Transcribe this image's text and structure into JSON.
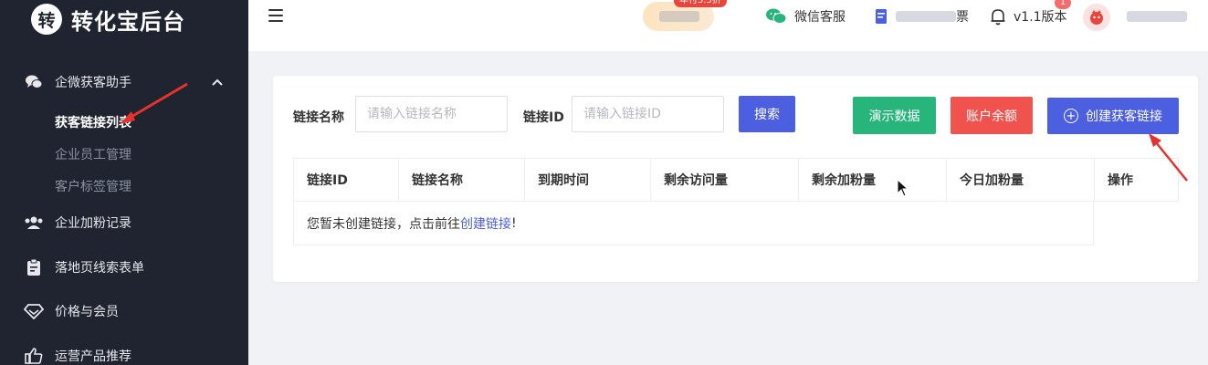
{
  "brand": {
    "logo_char": "转",
    "name": "转化宝后台"
  },
  "sidebar": {
    "groups": [
      {
        "label": "企微获客助手",
        "icon": "chat-bubbles-icon",
        "expanded": true
      },
      {
        "label": "企业加粉记录",
        "icon": "users-icon"
      },
      {
        "label": "落地页线索表单",
        "icon": "clipboard-icon"
      },
      {
        "label": "价格与会员",
        "icon": "diamond-icon"
      },
      {
        "label": "运营产品推荐",
        "icon": "thumbs-up-icon"
      }
    ],
    "submenu": [
      {
        "label": "获客链接列表",
        "active": true
      },
      {
        "label": "企业员工管理",
        "active": false
      },
      {
        "label": "客户标签管理",
        "active": false
      }
    ]
  },
  "topbar": {
    "promo_badge": "年付5.5折",
    "wechat_service": "微信客服",
    "invoice_label_tail": "票",
    "version": "v1.1版本",
    "notify_count": "1"
  },
  "filters": {
    "name_label": "链接名称",
    "name_placeholder": "请输入链接名称",
    "id_label": "链接ID",
    "id_placeholder": "请输入链接ID",
    "search_button": "搜索"
  },
  "actions": {
    "demo_button": "演示数据",
    "balance_button": "账户余额",
    "create_button": "创建获客链接"
  },
  "table": {
    "columns": [
      "链接ID",
      "链接名称",
      "到期时间",
      "剩余访问量",
      "剩余加粉量",
      "今日加粉量",
      "操作"
    ],
    "empty_prefix": "您暂未创建链接，点击前往",
    "empty_link": "创建链接",
    "empty_suffix": "!"
  },
  "colors": {
    "sidebar_bg": "#1f2430",
    "primary": "#4b5fe0",
    "success": "#27b57c",
    "danger": "#f0524e",
    "annotation": "#e5322d"
  }
}
